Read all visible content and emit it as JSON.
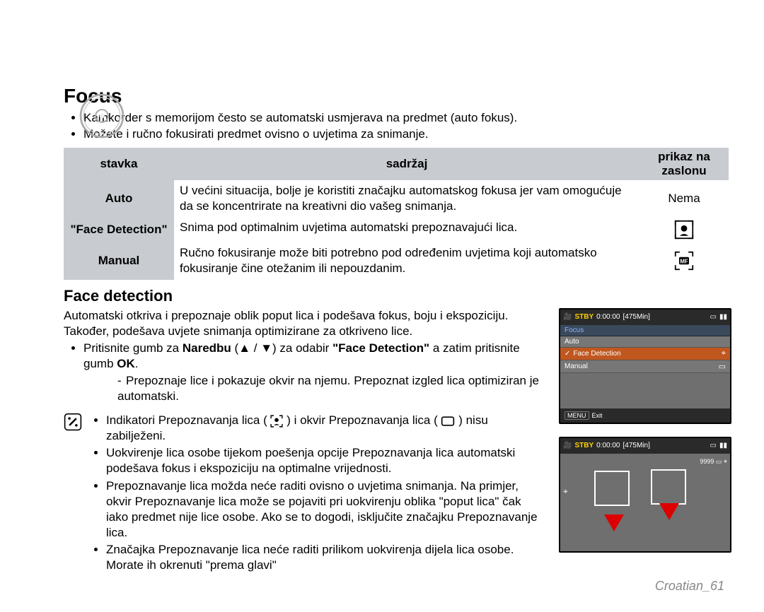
{
  "title": "Focus",
  "intro": [
    "Kamkorder s memorijom često se automatski usmjerava na predmet (auto fokus).",
    "Možete i ručno fokusirati predmet ovisno o uvjetima za snimanje."
  ],
  "table": {
    "headers": {
      "item": "stavka",
      "content": "sadržaj",
      "display": "prikaz na zaslonu"
    },
    "rows": [
      {
        "item": "Auto",
        "content": "U većini situacija, bolje je koristiti značajku automatskog fokusa jer vam omogućuje da se koncentrirate na kreativni dio vašeg snimanja.",
        "icon": "Nema"
      },
      {
        "item": "\"Face Detection\"",
        "content": "Snima pod optimalnim uvjetima automatski prepoznavajući lica.",
        "icon": "face"
      },
      {
        "item": "Manual",
        "content": "Ručno fokusiranje može biti potrebno pod određenim uvjetima koji automatsko fokusiranje čine otežanim ili nepouzdanim.",
        "icon": "mf"
      }
    ]
  },
  "fd": {
    "heading": "Face detection",
    "p1": "Automatski otkriva i prepoznaje oblik poput lica i podešava fokus, boju i ekspoziciju. Također, podešava uvjete snimanja optimizirane za otkriveno lice.",
    "p2a": "Pritisnite gumb za ",
    "p2_bold1": "Naredbu",
    "p2b": " (▲ / ▼) za odabir ",
    "p2_bold2": "\"Face Detection\"",
    "p2c": " a zatim pritisnite gumb ",
    "p2_bold3": "OK",
    "p2d": ".",
    "dash": "Prepoznaje lice i pokazuje okvir na njemu. Prepoznat izgled lica optimiziran je automatski."
  },
  "notes": {
    "n1a": "Indikatori Prepoznavanja lica ( ",
    "n1b": " ) i okvir Prepoznavanja lica ( ",
    "n1c": " ) nisu zabilježeni.",
    "n2": "Uokvirenje lica osobe tijekom poešenja opcije Prepoznavanja lica automatski podešava fokus i ekspoziciju na optimalne vrijednosti.",
    "n3": "Prepoznavanje lica možda neće raditi ovisno o uvjetima snimanja. Na primjer, okvir Prepoznavanje lica može se pojaviti pri uokvirenju oblika \"poput lica\" čak iako predmet nije lice osobe. Ako se to dogodi, isključite značajku Prepoznavanje lica.",
    "n4": "Značajka Prepoznavanje lica neće raditi prilikom uokvirenja dijela lica osobe. Morate ih okrenuti \"prema glavi\""
  },
  "screen1": {
    "stby": "STBY",
    "time": "0:00:00",
    "remain": "[475Min]",
    "header": "Focus",
    "items": {
      "auto": "Auto",
      "face": "Face Detection",
      "manual": "Manual"
    },
    "footer_menu": "MENU",
    "footer_exit": "Exit"
  },
  "screen2": {
    "stby": "STBY",
    "time": "0:00:00",
    "remain": "[475Min]",
    "count": "9999"
  },
  "footer": "Croatian_61"
}
